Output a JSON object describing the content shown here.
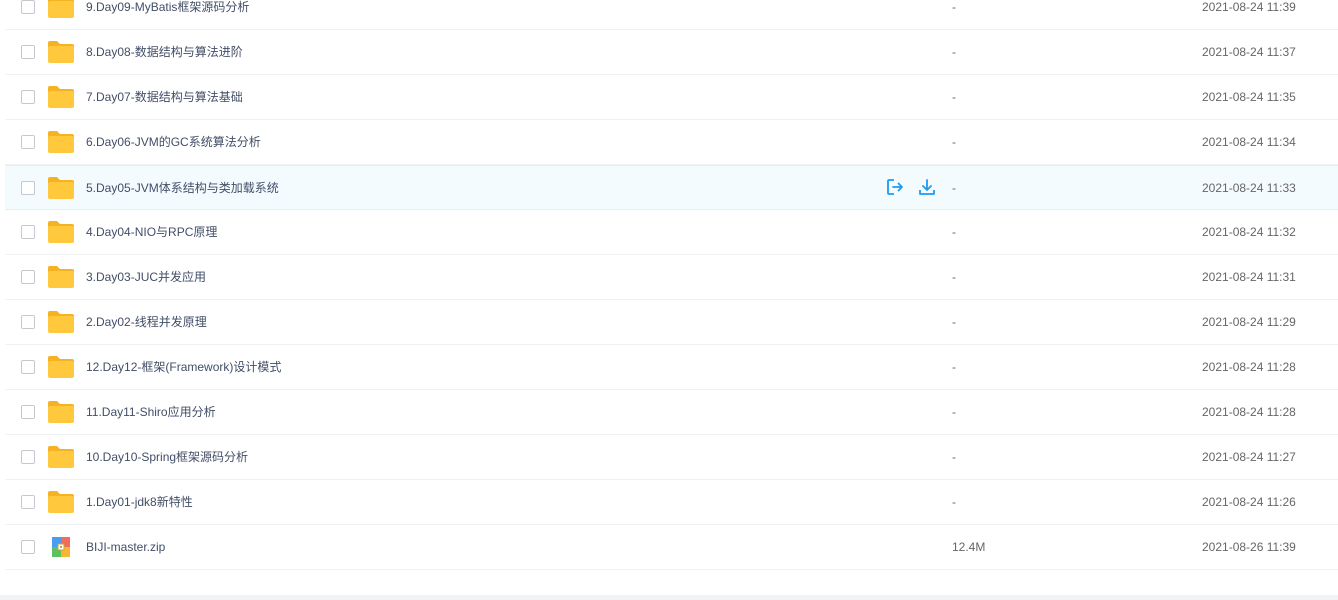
{
  "files": [
    {
      "name": "9.Day09-MyBatis框架源码分析",
      "type": "folder",
      "size": "-",
      "time": "2021-08-24 11:39"
    },
    {
      "name": "8.Day08-数据结构与算法进阶",
      "type": "folder",
      "size": "-",
      "time": "2021-08-24 11:37"
    },
    {
      "name": "7.Day07-数据结构与算法基础",
      "type": "folder",
      "size": "-",
      "time": "2021-08-24 11:35"
    },
    {
      "name": "6.Day06-JVM的GC系统算法分析",
      "type": "folder",
      "size": "-",
      "time": "2021-08-24 11:34"
    },
    {
      "name": "5.Day05-JVM体系结构与类加载系统",
      "type": "folder",
      "size": "-",
      "time": "2021-08-24 11:33",
      "hover": true
    },
    {
      "name": "4.Day04-NIO与RPC原理",
      "type": "folder",
      "size": "-",
      "time": "2021-08-24 11:32"
    },
    {
      "name": "3.Day03-JUC并发应用",
      "type": "folder",
      "size": "-",
      "time": "2021-08-24 11:31"
    },
    {
      "name": "2.Day02-线程并发原理",
      "type": "folder",
      "size": "-",
      "time": "2021-08-24 11:29"
    },
    {
      "name": "12.Day12-框架(Framework)设计模式",
      "type": "folder",
      "size": "-",
      "time": "2021-08-24 11:28"
    },
    {
      "name": "11.Day11-Shiro应用分析",
      "type": "folder",
      "size": "-",
      "time": "2021-08-24 11:28"
    },
    {
      "name": "10.Day10-Spring框架源码分析",
      "type": "folder",
      "size": "-",
      "time": "2021-08-24 11:27"
    },
    {
      "name": "1.Day01-jdk8新特性",
      "type": "folder",
      "size": "-",
      "time": "2021-08-24 11:26"
    },
    {
      "name": "BIJI-master.zip",
      "type": "zip",
      "size": "12.4M",
      "time": "2021-08-26 11:39"
    }
  ],
  "colors": {
    "folder": "#ffc83d",
    "folder_back": "#f5b323",
    "action": "#1e9bf0",
    "hover_bg": "#f4fbff"
  },
  "hover_actions": [
    "share-icon",
    "download-icon"
  ]
}
